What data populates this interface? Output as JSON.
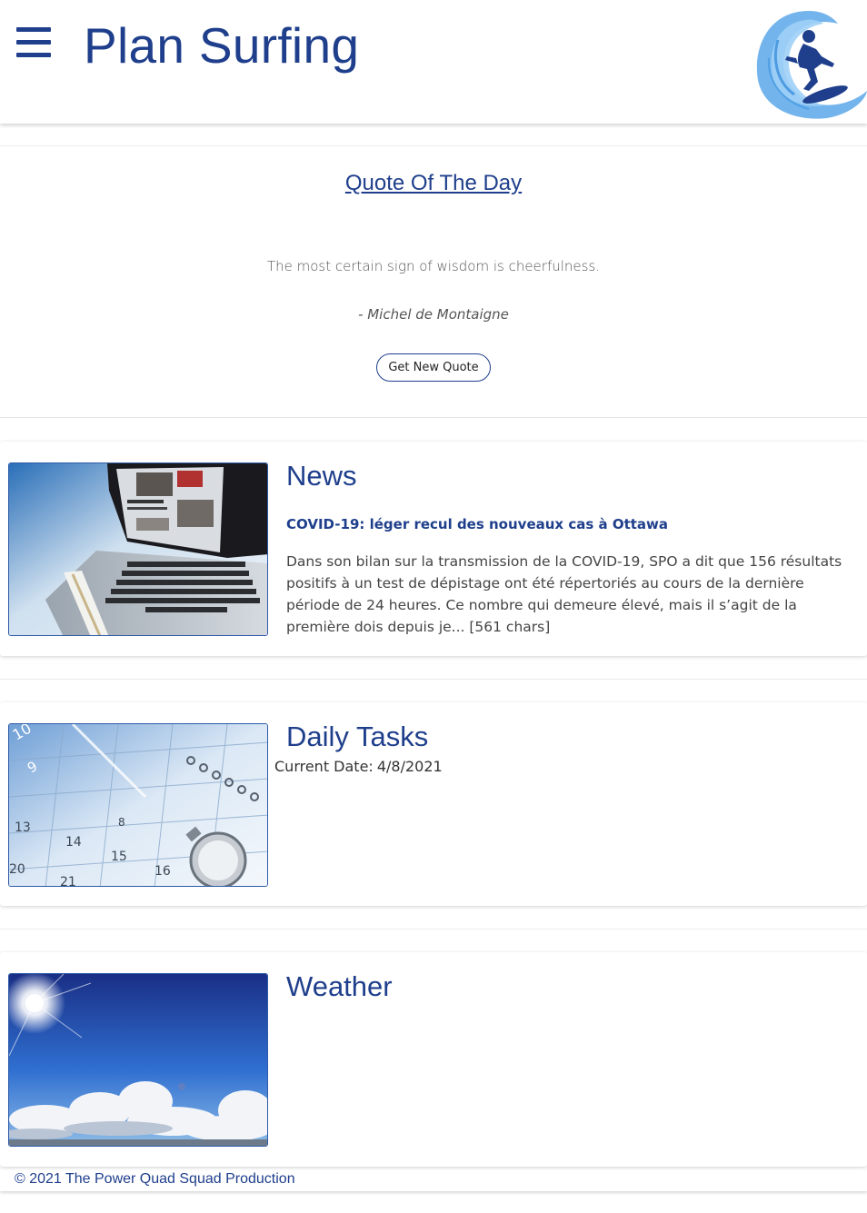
{
  "header": {
    "title": "Plan Surfing",
    "menu_icon": "hamburger-menu-icon",
    "logo_icon": "surfer-wave-logo",
    "accent_color": "#1f3f8c"
  },
  "quote": {
    "title": "Quote Of The Day",
    "text": "The most certain sign of wisdom is cheerfulness.",
    "author": "- Michel de Montaigne",
    "button_label": "Get New Quote"
  },
  "news": {
    "title": "News",
    "headline": "COVID-19: léger recul des nouveaux cas à Ottawa",
    "body": "Dans son bilan sur la transmission de la COVID-19, SPO a dit que 156 résultats positifs à un test de dépistage ont été répertoriés au cours de la dernière période de 24 heures. Ce nombre qui demeure élevé, mais il s’agit de la première dois depuis je... [561 chars]",
    "image": "laptop-news-image"
  },
  "tasks": {
    "title": "Daily Tasks",
    "date_label": "Current Date:",
    "date_value": "4/8/2021",
    "image": "calendar-planner-image",
    "calendar_numbers": [
      "10",
      "9",
      "13",
      "14",
      "15",
      "16",
      "20",
      "21",
      "8"
    ]
  },
  "weather": {
    "title": "Weather",
    "image": "sunny-sky-image"
  },
  "footer": {
    "text": "© 2021 The Power Quad Squad Production"
  }
}
